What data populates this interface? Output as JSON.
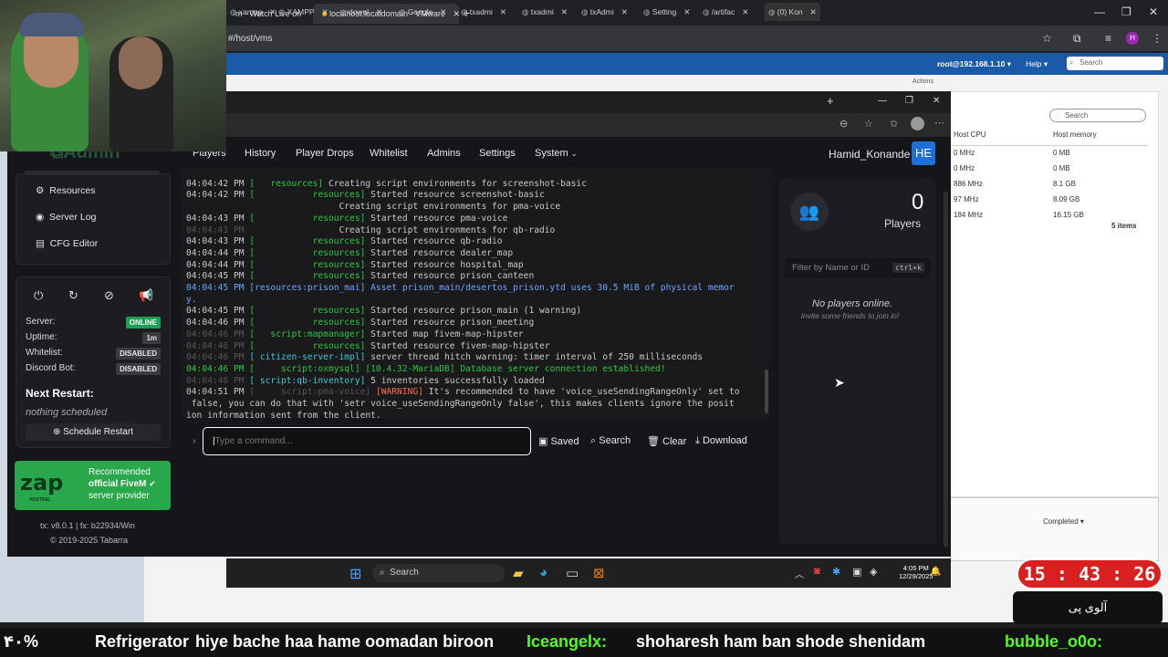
{
  "chrome": {
    "tabs": [
      "m - Watch Live on",
      "localhost.localdomain - VMware"
    ],
    "url": "#/host/vms"
  },
  "vmware": {
    "user": "root@192.168.1.10 ▾",
    "help": "Help ▾",
    "search_placeholder": "Search",
    "actions": "Actions",
    "table_search": "Search",
    "col_cpu": "Host CPU",
    "col_mem": "Host memory",
    "rows": [
      [
        "0 MHz",
        "0 MB"
      ],
      [
        "0 MHz",
        "0 MB"
      ],
      [
        "886 MHz",
        "8.1 GB"
      ],
      [
        "97 MHz",
        "8.09 GB"
      ],
      [
        "184 MHz",
        "16.15 GB"
      ]
    ],
    "items": "5 items",
    "completed": "Completed ▾"
  },
  "inner_tabs": [
    "xampp",
    "XAMPP",
    "downl",
    "Google",
    "txadmi",
    "txadmi",
    "txAdmi",
    "Setting",
    "/artifac",
    "(0) Kon"
  ],
  "nav": {
    "players": "Players",
    "history": "History",
    "drops": "Player Drops",
    "whitelist": "Whitelist",
    "admins": "Admins",
    "settings": "Settings",
    "system": "System",
    "user": "Hamid_Konande",
    "avatar": "HE"
  },
  "sidebar": {
    "brand": "Admin",
    "links": [
      "Resources",
      "Server Log",
      "CFG Editor"
    ],
    "status": [
      {
        "label": "Server:",
        "value": "ONLINE"
      },
      {
        "label": "Uptime:",
        "value": "1m"
      },
      {
        "label": "Whitelist:",
        "value": "DISABLED"
      },
      {
        "label": "Discord Bot:",
        "value": "DISABLED"
      }
    ],
    "next_restart": "Next Restart:",
    "restart_value": "nothing scheduled",
    "schedule_btn": "Schedule Restart",
    "zap": {
      "name": "zap",
      "sub": "HOSTING",
      "line1": "Recommended",
      "line2": "official FiveM",
      "line3": "server provider"
    },
    "version": "tx: v8.0.1 | fx: b22934/Win",
    "copyright": "© 2019-2025 Tabarra"
  },
  "console": {
    "lines": [
      [
        "04:04:42 PM",
        "[",
        "   resources]",
        " Creating script environments for screenshot-basic"
      ],
      [
        "04:04:42 PM",
        "[",
        "           resources]",
        " Started resource screenshot-basic"
      ],
      [
        "",
        "",
        "",
        "                 Creating script environments for pma-voice"
      ],
      [
        "04:04:43 PM",
        "[",
        "           resources]",
        " Started resource pma-voice"
      ],
      [
        "04:04:43 PM",
        "",
        "",
        "                 Creating script environments for qb-radio"
      ],
      [
        "04:04:43 PM",
        "[",
        "           resources]",
        " Started resource qb-radio"
      ],
      [
        "04:04:44 PM",
        "[",
        "           resources]",
        " Started resource dealer_map"
      ],
      [
        "04:04:44 PM",
        "[",
        "           resources]",
        " Started resource hospital_map"
      ],
      [
        "04:04:45 PM",
        "[",
        "           resources]",
        " Started resource prison_canteen"
      ]
    ],
    "asset_line": "04:04:45 PM [resources:prison_mai] Asset prison_main/desertos_prison.ytd uses 30.5 MiB of physical memor",
    "asset_wrap": "y.",
    "lines2": [
      [
        "04:04:45 PM",
        "[           resources]",
        " Started resource prison_main (1 warning)"
      ],
      [
        "04:04:46 PM",
        "[           resources]",
        " Started resource prison_meeting"
      ],
      [
        "04:04:46 PM",
        "[   script:mapmanager]",
        " Started map fivem-map-hipster"
      ],
      [
        "04:04:46 PM",
        "[           resources]",
        " Started resource fivem-map-hipster"
      ],
      [
        "04:04:46 PM",
        "[ citizen-server-impl]",
        " server thread hitch warning: timer interval of 250 milliseconds"
      ]
    ],
    "mariadb": "04:04:46 PM [     script:oxmysql] [10.4.32-MariaDB] Database server connection established!",
    "inv_time": "04:04:46 PM",
    "inv_tag": "[ script:qb-inventory]",
    "inv_msg": " 5 inventories successfully loaded",
    "warn_time": "04:04:51 PM",
    "warn_tag": "[     script:pma-voice]",
    "warn_label": "[WARNING]",
    "warn_msg": " It's recommended to have 'voice_useSendingRangeOnly' set to",
    "warn_wrap1": " false, you can do that with 'setr voice_useSendingRangeOnly false', this makes clients ignore the posit",
    "warn_wrap2": "ion information sent from the client."
  },
  "cmd": {
    "placeholder": "Type a command...",
    "saved": "Saved",
    "search": "Search",
    "clear": "Clear",
    "download": "Download"
  },
  "players": {
    "count": "0",
    "label": "Players",
    "filter_placeholder": "Filter by Name or ID",
    "shortcut": "ctrl+k",
    "empty": "No players online.",
    "empty_sub": "invite some friends to join in!"
  },
  "taskbar": {
    "search": "Search",
    "time": "4:05 PM",
    "date": "12/29/2025"
  },
  "overlay": {
    "clock": "15 : 43 : 26",
    "persian": "آلوی پی",
    "ticker": [
      {
        "text": "۴۰%",
        "color": "#ffffff"
      },
      {
        "text": "Refrigerator",
        "color": "#ffffff"
      },
      {
        "text": "hiye bache haa hame oomadan biroon",
        "color": "#ffffff"
      },
      {
        "text": "Iceangelx:",
        "color": "#53fc18"
      },
      {
        "text": "shoharesh ham ban shode shenidam",
        "color": "#ffffff"
      },
      {
        "text": "bubble_o0o:",
        "color": "#53fc18"
      }
    ]
  }
}
